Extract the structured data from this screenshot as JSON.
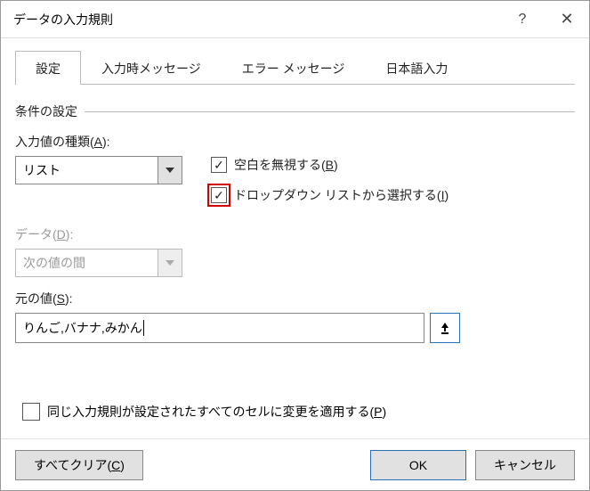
{
  "window": {
    "title": "データの入力規則"
  },
  "tabs": [
    "設定",
    "入力時メッセージ",
    "エラー メッセージ",
    "日本語入力"
  ],
  "activeTab": 0,
  "section": {
    "title": "条件の設定"
  },
  "allow": {
    "label": "入力値の種類(A):",
    "value": "リスト"
  },
  "data_field": {
    "label": "データ(D):",
    "value": "次の値の間"
  },
  "ignore_blank": {
    "label": "空白を無視する(B)",
    "checked": true
  },
  "in_cell_dd": {
    "label": "ドロップダウン リストから選択する(I)",
    "checked": true
  },
  "source": {
    "label": "元の値(S):",
    "value": "りんご,バナナ,みかん"
  },
  "apply_all": {
    "label": "同じ入力規則が設定されたすべてのセルに変更を適用する(P)",
    "checked": false
  },
  "buttons": {
    "clear": "すべてクリア(C)",
    "ok": "OK",
    "cancel": "キャンセル"
  }
}
